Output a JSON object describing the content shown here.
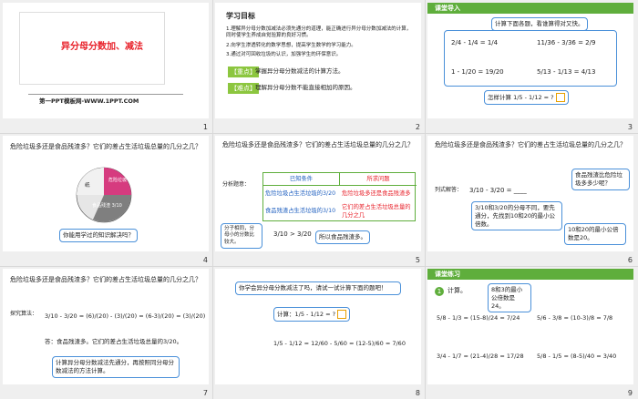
{
  "slides": [
    {
      "num": "1",
      "title": "异分母分数加、减法",
      "brand": "第一PPT模板网-WWW.1PPT.COM"
    },
    {
      "num": "2",
      "title": "学习目标",
      "goals": [
        "1.理解异分母分数加减法必须先通分的道理，能正确进行异分母分数加减法的计算，同时使学生养成自觉验算的良好习惯。",
        "2.向学生渗透转化的数学思想，提高学生数学的学习能力。",
        "3.通过对可回收垃圾的认识，加强学生的环保意识。"
      ],
      "key_label": "【重点】",
      "key_text": "掌握异分母分数减法的计算方法。",
      "diff_label": "【难点】",
      "diff_text": "理解异分母分数不能直接相加的原因。"
    },
    {
      "num": "3",
      "title": "课堂导入",
      "prompt": "计算下面各题，看谁算得对又快。",
      "eq1": "2/4 - 1/4 = 1/4",
      "eq2": "11/36 - 3/36 = 2/9",
      "eq3": "1 - 1/20 = 19/20",
      "eq4": "5/13 - 1/13 = 4/13",
      "question": "怎样计算 1/5 - 1/12 = ?"
    },
    {
      "num": "4",
      "question": "危险垃圾多还是食品残渣多？它们的差占生活垃圾总量的几分之几？",
      "pie_labels": [
        "纸",
        "食品残渣 3/10",
        "危险垃圾 3/20"
      ],
      "hint": "你能用学过的知识解决吗？"
    },
    {
      "num": "5",
      "question": "危险垃圾多还是食品残渣多？它们的差占生活垃圾总量的几分之几？",
      "analysis": "分析题意：",
      "known": "已知条件",
      "asked": "所求问题",
      "row1a": "危险垃圾占生活垃圾的3/20",
      "row1b": "危险垃圾多还是食品残渣多",
      "row2a": "食品残渣占生活垃圾的3/10",
      "row2b": "它们的差占生活垃圾总量的几分之几",
      "note": "分子相同，分母小的分数比较大。",
      "compare": "3/10 > 3/20",
      "conclusion": "所以食品残渣多。"
    },
    {
      "num": "6",
      "question": "危险垃圾多还是食品残渣多？它们的差占生活垃圾总量的几分之几？",
      "bubble1": "食品残渣比危险垃圾多多少呢？",
      "formula_label": "列式解答：",
      "formula": "3/10 - 3/20 = ____",
      "bubble2": "3/10和3/20的分母不同，要先通分，先找到10和20的最小公倍数。",
      "bubble3": "10和20的最小公倍数是20。"
    },
    {
      "num": "7",
      "question": "危险垃圾多还是食品残渣多？它们的差占生活垃圾总量的几分之几？",
      "method": "探究算法：",
      "calc": "3/10 - 3/20 = (6)/(20) - (3)/(20) = (6-3)/(20) = (3)/(20)",
      "answer": "答：食品残渣多。它们的差占生活垃圾总量的3/20。",
      "summary": "计算异分母分数减法先通分，再按照同分母分数减法的方法计算。"
    },
    {
      "num": "8",
      "bubble": "你学会异分母分数减法了吗，请试一试计算下面的题吧！",
      "task": "计算：1/5 - 1/12 = ?",
      "solution": "1/5 - 1/12 = 12/60 - 5/60 = (12-5)/60 = 7/60"
    },
    {
      "num": "9",
      "title": "课堂练习",
      "task_label": "计算。",
      "bubble": "8和3的最小公倍数是24。",
      "p1": "5/8 - 1/3 = (15-8)/24 = 7/24",
      "p2": "5/6 - 3/8 = (10-3)/8 = 7/8",
      "p3": "3/4 - 1/7 = (21-4)/28 = 17/28",
      "p4": "5/8 - 1/5 = (8-5)/40 = 3/40"
    }
  ]
}
